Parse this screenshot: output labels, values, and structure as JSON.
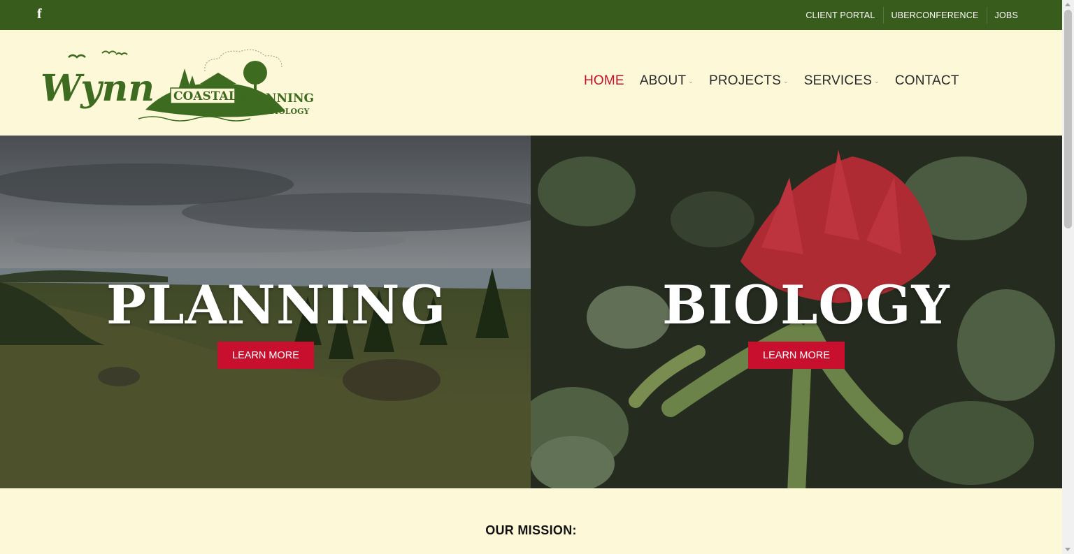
{
  "topbar": {
    "social_icon": "facebook-icon",
    "facebook_glyph": "f",
    "links": [
      "CLIENT PORTAL",
      "UBERCONFERENCE",
      "JOBS"
    ]
  },
  "logo": {
    "script_text": "Wynn",
    "line1": "COASTAL",
    "line2": "PLANNING",
    "line3": "& BIOLOGY"
  },
  "nav": {
    "items": [
      {
        "label": "HOME",
        "active": true
      },
      {
        "label": "ABOUT",
        "dropdown": true
      },
      {
        "label": "PROJECTS",
        "dropdown": true
      },
      {
        "label": "SERVICES",
        "dropdown": true
      },
      {
        "label": "CONTACT"
      }
    ],
    "chevron_glyph": "⌄"
  },
  "hero": {
    "planning": {
      "title": "PLANNING",
      "button": "LEARN MORE"
    },
    "biology": {
      "title": "BIOLOGY",
      "button": "LEARN MORE"
    }
  },
  "mission": {
    "heading": "OUR MISSION:"
  },
  "colors": {
    "topbar": "#385c1c",
    "background": "#fdf8d8",
    "accent": "#c8102e",
    "logo_green": "#3d6b1f"
  }
}
